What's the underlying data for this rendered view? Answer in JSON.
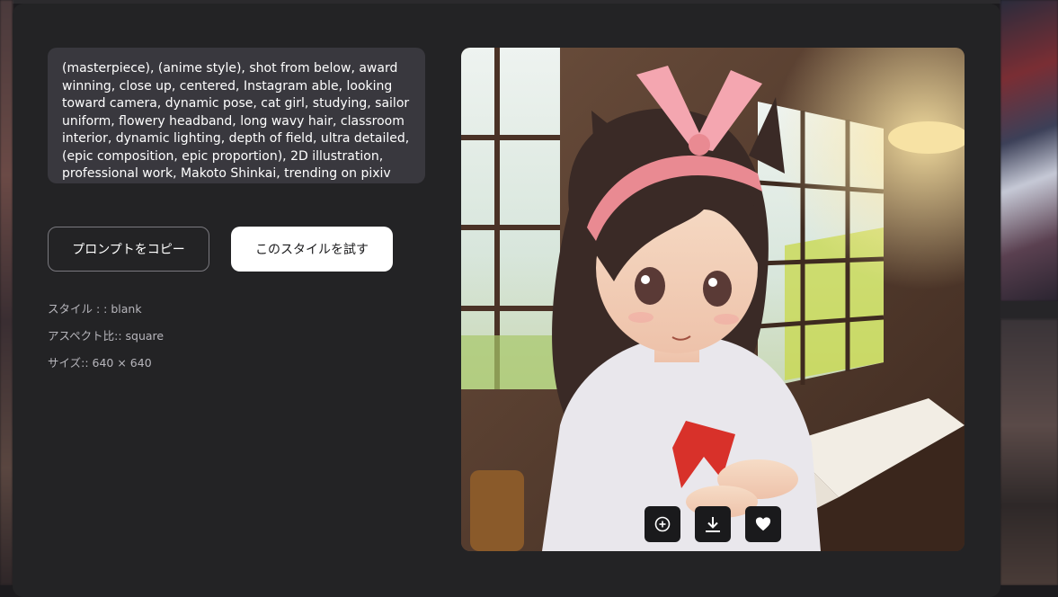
{
  "prompt": {
    "text": "(masterpiece), (anime style), shot from below, award winning, close up, centered, Instagram able, looking toward camera, dynamic pose, cat girl, studying, sailor uniform, flowery headband, long wavy hair, classroom interior, dynamic lighting, depth of field, ultra detailed, (epic composition, epic proportion), 2D illustration, professional work, Makoto Shinkai, trending on pixiv"
  },
  "buttons": {
    "copy_prompt": "プロンプトをコピー",
    "try_style": "このスタイルを試す"
  },
  "details": {
    "style": "スタイル : : blank",
    "aspect": "アスペクト比:: square",
    "size": "サイズ:: 640 × 640"
  },
  "image_actions": [
    {
      "name": "zoom-plus-icon"
    },
    {
      "name": "download-icon"
    },
    {
      "name": "heart-icon"
    }
  ],
  "colors": {
    "modal_bg": "#232325",
    "prompt_bg": "#39383e",
    "page_bg": "#1c1b1e"
  }
}
